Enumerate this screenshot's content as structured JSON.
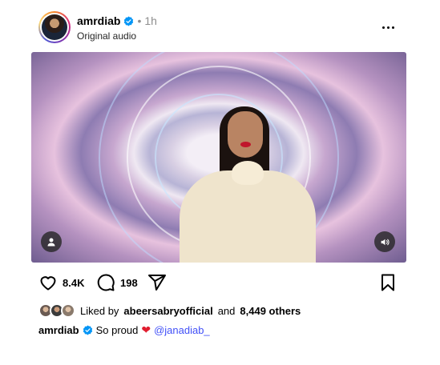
{
  "post": {
    "username": "amrdiab",
    "separator": "•",
    "time": "1h",
    "audio": "Original audio",
    "verified_color": "#0095f6"
  },
  "actions": {
    "likes": "8.4K",
    "comments": "198"
  },
  "liked_by": {
    "prefix": "Liked by",
    "user": "abeersabryofficial",
    "middle": "and",
    "others": "8,449 others"
  },
  "caption": {
    "username": "amrdiab",
    "text": "So proud",
    "emoji": "❤",
    "mention": "@janadiab_"
  },
  "icons": {
    "more": "more-options-icon",
    "like": "heart-icon",
    "comment": "comment-icon",
    "share": "share-icon",
    "save": "bookmark-icon",
    "user_tag": "user-tag-icon",
    "audio": "speaker-icon"
  },
  "colors": {
    "mention": "#4150f7",
    "heart": "#e11d2f"
  }
}
